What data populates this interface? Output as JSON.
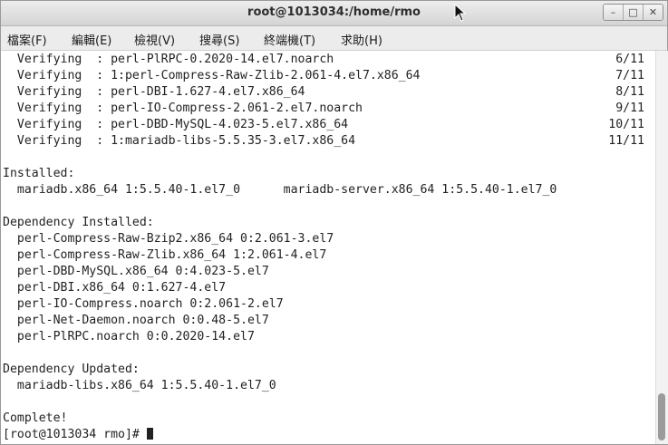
{
  "window": {
    "title": "root@1013034:/home/rmo"
  },
  "window_buttons": [
    {
      "name": "minimize-button",
      "glyph": "–"
    },
    {
      "name": "maximize-button",
      "glyph": "□"
    },
    {
      "name": "close-button",
      "glyph": "✕"
    }
  ],
  "menu": [
    "檔案(F)",
    "編輯(E)",
    "檢視(V)",
    "搜尋(S)",
    "終端機(T)",
    "求助(H)"
  ],
  "terminal": {
    "lines": [
      {
        "text": "  Verifying  : perl-PlRPC-0.2020-14.el7.noarch",
        "right": "6/11"
      },
      {
        "text": "  Verifying  : 1:perl-Compress-Raw-Zlib-2.061-4.el7.x86_64",
        "right": "7/11"
      },
      {
        "text": "  Verifying  : perl-DBI-1.627-4.el7.x86_64",
        "right": "8/11"
      },
      {
        "text": "  Verifying  : perl-IO-Compress-2.061-2.el7.noarch",
        "right": "9/11"
      },
      {
        "text": "  Verifying  : perl-DBD-MySQL-4.023-5.el7.x86_64",
        "right": "10/11"
      },
      {
        "text": "  Verifying  : 1:mariadb-libs-5.5.35-3.el7.x86_64",
        "right": "11/11"
      },
      {
        "text": "",
        "right": ""
      },
      {
        "text": "Installed:",
        "right": ""
      },
      {
        "text": "  mariadb.x86_64 1:5.5.40-1.el7_0      mariadb-server.x86_64 1:5.5.40-1.el7_0",
        "right": ""
      },
      {
        "text": "",
        "right": ""
      },
      {
        "text": "Dependency Installed:",
        "right": ""
      },
      {
        "text": "  perl-Compress-Raw-Bzip2.x86_64 0:2.061-3.el7",
        "right": ""
      },
      {
        "text": "  perl-Compress-Raw-Zlib.x86_64 1:2.061-4.el7",
        "right": ""
      },
      {
        "text": "  perl-DBD-MySQL.x86_64 0:4.023-5.el7",
        "right": ""
      },
      {
        "text": "  perl-DBI.x86_64 0:1.627-4.el7",
        "right": ""
      },
      {
        "text": "  perl-IO-Compress.noarch 0:2.061-2.el7",
        "right": ""
      },
      {
        "text": "  perl-Net-Daemon.noarch 0:0.48-5.el7",
        "right": ""
      },
      {
        "text": "  perl-PlRPC.noarch 0:0.2020-14.el7",
        "right": ""
      },
      {
        "text": "",
        "right": ""
      },
      {
        "text": "Dependency Updated:",
        "right": ""
      },
      {
        "text": "  mariadb-libs.x86_64 1:5.5.40-1.el7_0",
        "right": ""
      },
      {
        "text": "",
        "right": ""
      },
      {
        "text": "Complete!",
        "right": ""
      }
    ],
    "prompt": "[root@1013034 rmo]# "
  }
}
